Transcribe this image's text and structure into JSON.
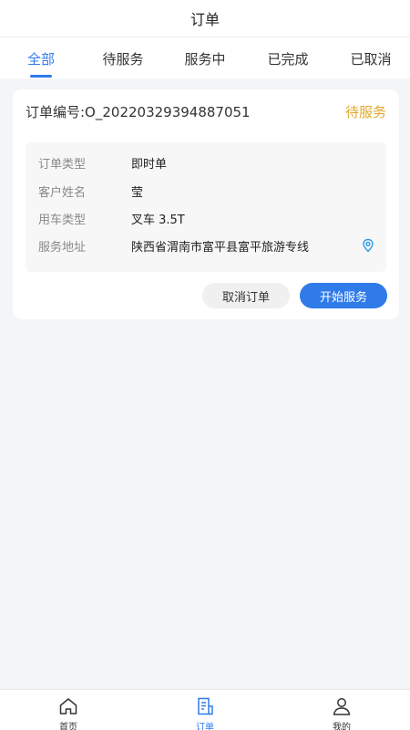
{
  "header": {
    "title": "订单"
  },
  "tabs": [
    {
      "label": "全部",
      "active": true
    },
    {
      "label": "待服务",
      "active": false
    },
    {
      "label": "服务中",
      "active": false
    },
    {
      "label": "已完成",
      "active": false
    },
    {
      "label": "已取消",
      "active": false
    }
  ],
  "order": {
    "number": "订单编号:O_20220329394887051",
    "status": "待服务",
    "details": [
      {
        "label": "订单类型",
        "value": "即时单"
      },
      {
        "label": "客户姓名",
        "value": "莹"
      },
      {
        "label": "用车类型",
        "value": "叉车 3.5T"
      },
      {
        "label": "服务地址",
        "value": "陕西省渭南市富平县富平旅游专线"
      }
    ],
    "cancel_label": "取消订单",
    "start_label": "开始服务"
  },
  "bottom_nav": [
    {
      "label": "首页",
      "icon": "home-icon",
      "active": false
    },
    {
      "label": "订单",
      "icon": "order-icon",
      "active": true
    },
    {
      "label": "我的",
      "icon": "profile-icon",
      "active": false
    }
  ],
  "colors": {
    "accent": "#2f7bea",
    "status_pending": "#e3a72a",
    "background": "#f4f5f7"
  }
}
